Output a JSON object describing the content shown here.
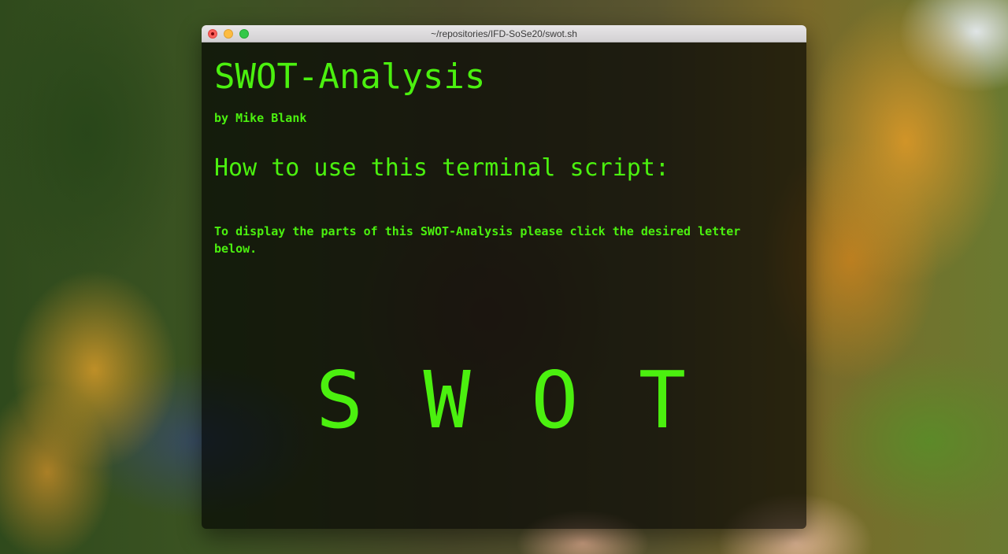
{
  "window": {
    "title": "~/repositories/IFD-SoSe20/swot.sh"
  },
  "terminal": {
    "heading": "SWOT-Analysis",
    "author": "by Mike Blank",
    "subheading": "How to use this terminal script:",
    "instructions": "To display the parts of this SWOT-Analysis please click the desired letter below.",
    "letters": [
      "S",
      "W",
      "O",
      "T"
    ],
    "text_color": "#4bf00f"
  },
  "colors": {
    "close": "#fc605c",
    "minimize": "#fdbc40",
    "zoom": "#34c84a"
  },
  "icons": [
    "close-window-icon",
    "minimize-window-icon",
    "zoom-window-icon"
  ]
}
